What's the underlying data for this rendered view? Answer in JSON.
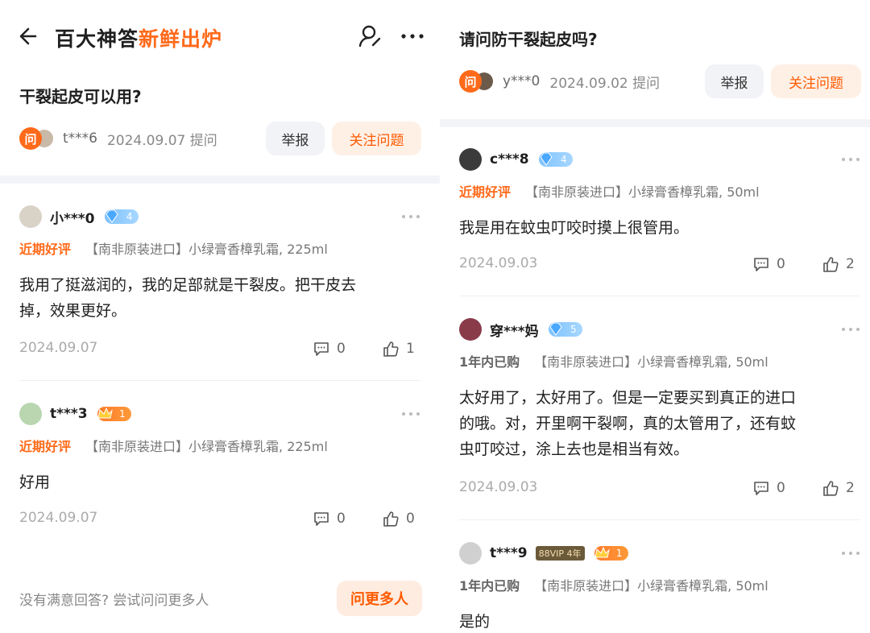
{
  "colors": {
    "accent": "#ff6a1a",
    "divider": "#f3f4f8"
  },
  "left": {
    "header": {
      "title_main": "百大神答",
      "title_highlight": "新鲜出炉"
    },
    "question": {
      "title": "干裂起皮可以用?",
      "asker_badge": "问",
      "asker_name": "t***6",
      "asker_date": "2024.09.07 提问",
      "report_label": "举报",
      "follow_label": "关注问题"
    },
    "answers": [
      {
        "user": "小***0",
        "level": "4",
        "tag": "近期好评",
        "product": "【南非原装进口】小绿膏香樟乳霜, 225ml",
        "lines": [
          "我用了挺滋润的，我的足部就是干裂皮。把干皮去",
          "掉，效果更好。"
        ],
        "date": "2024.09.07",
        "comments": "0",
        "likes": "1"
      },
      {
        "user": "t***3",
        "level": "1",
        "tag": "近期好评",
        "product": "【南非原装进口】小绿膏香樟乳霜, 225ml",
        "lines": [
          "好用"
        ],
        "date": "2024.09.07",
        "comments": "0",
        "likes": "0"
      }
    ],
    "footer": {
      "text": "没有满意回答? 尝试问问更多人",
      "button": "问更多人"
    }
  },
  "right": {
    "question": {
      "title": "请问防干裂起皮吗?",
      "asker_badge": "问",
      "asker_name": "y***0",
      "asker_date": "2024.09.02 提问",
      "report_label": "举报",
      "follow_label": "关注问题"
    },
    "answers": [
      {
        "user": "c***8",
        "level": "4",
        "tag": "近期好评",
        "product": "【南非原装进口】小绿膏香樟乳霜, 50ml",
        "lines": [
          "我是用在蚊虫叮咬时摸上很管用。"
        ],
        "date": "2024.09.03",
        "comments": "0",
        "likes": "2"
      },
      {
        "user": "穿***妈",
        "level": "5",
        "tag": "1年内已购",
        "product": "【南非原装进口】小绿膏香樟乳霜, 50ml",
        "lines": [
          "太好用了，太好用了。但是一定要买到真正的进口",
          "的哦。对，开里啊干裂啊，真的太管用了，还有蚊",
          "虫叮咬过，涂上去也是相当有效。"
        ],
        "date": "2024.09.03",
        "comments": "0",
        "likes": "2"
      },
      {
        "user": "t***9",
        "vip": "88VIP",
        "vip_years": "4年",
        "level": "1",
        "tag": "1年内已购",
        "product": "【南非原装进口】小绿膏香樟乳霜, 50ml",
        "lines": [
          "是的"
        ]
      }
    ]
  }
}
